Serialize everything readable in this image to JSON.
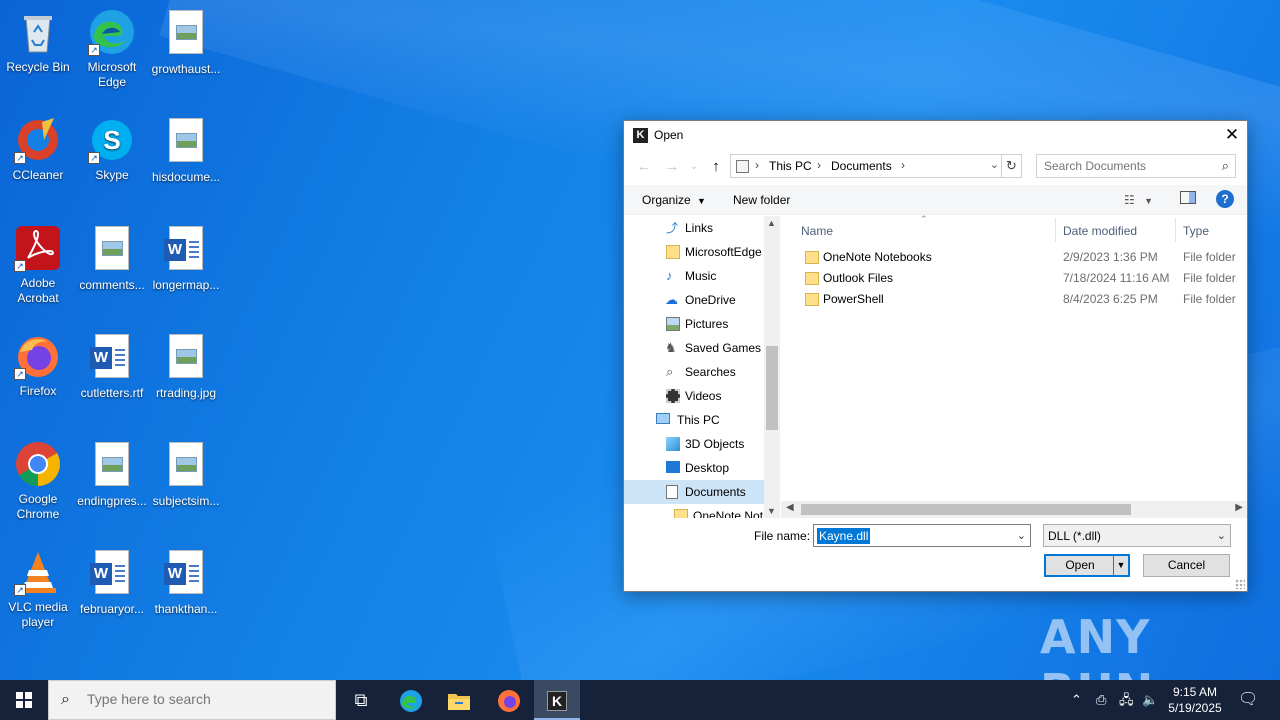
{
  "desktop": {
    "icons": [
      {
        "label": "Recycle Bin"
      },
      {
        "label": "Microsoft Edge"
      },
      {
        "label": "growthaust..."
      },
      {
        "label": "CCleaner"
      },
      {
        "label": "Skype"
      },
      {
        "label": "hisdocume..."
      },
      {
        "label": "Adobe Acrobat"
      },
      {
        "label": "comments..."
      },
      {
        "label": "longermap..."
      },
      {
        "label": "Firefox"
      },
      {
        "label": "cutletters.rtf"
      },
      {
        "label": "rtrading.jpg"
      },
      {
        "label": "Google Chrome"
      },
      {
        "label": "endingpres..."
      },
      {
        "label": "subjectsim..."
      },
      {
        "label": "VLC media player"
      },
      {
        "label": "februaryor..."
      },
      {
        "label": "thankthan..."
      }
    ],
    "watermark": "ANY RUN"
  },
  "dialog": {
    "title": "Open",
    "address": {
      "crumbs": [
        "This PC",
        "Documents"
      ]
    },
    "search_placeholder": "Search Documents",
    "toolbar": {
      "organize": "Organize",
      "new_folder": "New folder"
    },
    "tree": [
      {
        "label": "Links",
        "icon": "link-icon"
      },
      {
        "label": "MicrosoftEdge",
        "icon": "folder-icon"
      },
      {
        "label": "Music",
        "icon": "music-icon"
      },
      {
        "label": "OneDrive",
        "icon": "cloud-icon"
      },
      {
        "label": "Pictures",
        "icon": "pictures-icon"
      },
      {
        "label": "Saved Games",
        "icon": "games-icon"
      },
      {
        "label": "Searches",
        "icon": "search-icon"
      },
      {
        "label": "Videos",
        "icon": "video-icon"
      },
      {
        "label": "This PC",
        "icon": "pc-icon"
      },
      {
        "label": "3D Objects",
        "icon": "cube-icon"
      },
      {
        "label": "Desktop",
        "icon": "desktop-icon"
      },
      {
        "label": "Documents",
        "icon": "document-icon"
      },
      {
        "label": "OneNote Not",
        "icon": "folder-icon"
      }
    ],
    "columns": {
      "name": "Name",
      "date": "Date modified",
      "type": "Type"
    },
    "files": [
      {
        "name": "OneNote Notebooks",
        "date": "2/9/2023 1:36 PM",
        "type": "File folder"
      },
      {
        "name": "Outlook Files",
        "date": "7/18/2024 11:16 AM",
        "type": "File folder"
      },
      {
        "name": "PowerShell",
        "date": "8/4/2023 6:25 PM",
        "type": "File folder"
      }
    ],
    "file_name_label": "File name:",
    "file_name_value": "Kayne.dll",
    "filter_value": "DLL (*.dll)",
    "open_label": "Open",
    "cancel_label": "Cancel"
  },
  "taskbar": {
    "search_placeholder": "Type here to search",
    "time": "9:15 AM",
    "date": "5/19/2025"
  },
  "colors": {
    "accent": "#0078d7",
    "taskbar": "#16223a",
    "selected": "#cce4f7"
  }
}
